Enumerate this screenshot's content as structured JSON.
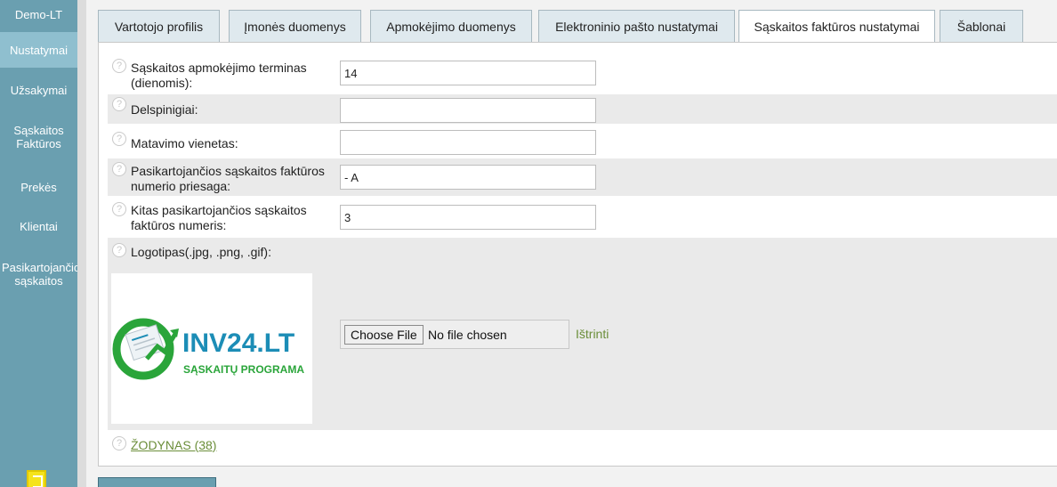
{
  "sidebar": {
    "brand": "Demo-LT",
    "items": [
      {
        "label": "Nustatymai"
      },
      {
        "label": "Užsakymai"
      },
      {
        "label_line1": "Sąskaitos",
        "label_line2": "Faktūros"
      },
      {
        "label": "Prekės"
      },
      {
        "label": "Klientai"
      },
      {
        "label_line1": "Pasikartojančios",
        "label_line2": "sąskaitos"
      }
    ],
    "exit_icon": "exit-icon"
  },
  "tabs": [
    {
      "label": "Vartotojo profilis"
    },
    {
      "label": "Įmonės duomenys"
    },
    {
      "label": "Apmokėjimo duomenys"
    },
    {
      "label": "Elektroninio pašto nustatymai"
    },
    {
      "label": "Sąskaitos faktūros nustatymai"
    },
    {
      "label": "Šablonai"
    }
  ],
  "active_tab": "Sąskaitos faktūros nustatymai",
  "form": {
    "help_glyph": "?",
    "payment_term": {
      "label_line1": "Sąskaitos apmokėjimo terminas",
      "label_line2": "(dienomis):",
      "value": "14"
    },
    "penalty": {
      "label": "Delspinigiai:",
      "value": ""
    },
    "unit": {
      "label": "Matavimo vienetas:",
      "value": ""
    },
    "suffix": {
      "label_line1": "Pasikartojančios sąskaitos faktūros",
      "label_line2": "numerio priesaga:",
      "value": "- A"
    },
    "next_number": {
      "label_line1": "Kitas pasikartojančios sąskaitos",
      "label_line2": "faktūros numeris:",
      "value": "3"
    },
    "logo": {
      "label": "Logotipas(.jpg, .png, .gif):",
      "brand_text": "INV24.LT",
      "brand_sub": "SĄSKAITŲ PROGRAMA",
      "choose_button": "Choose File",
      "file_status": "No file chosen",
      "delete_link": "Ištrinti"
    },
    "dictionary_link": "ŽODYNAS (38)"
  },
  "colors": {
    "sidebar": "#6a9fb0",
    "sidebar_active": "#8fbfcf",
    "link": "#6b8e3a",
    "logo_green": "#2aa53a",
    "logo_blue": "#1c8db6"
  }
}
